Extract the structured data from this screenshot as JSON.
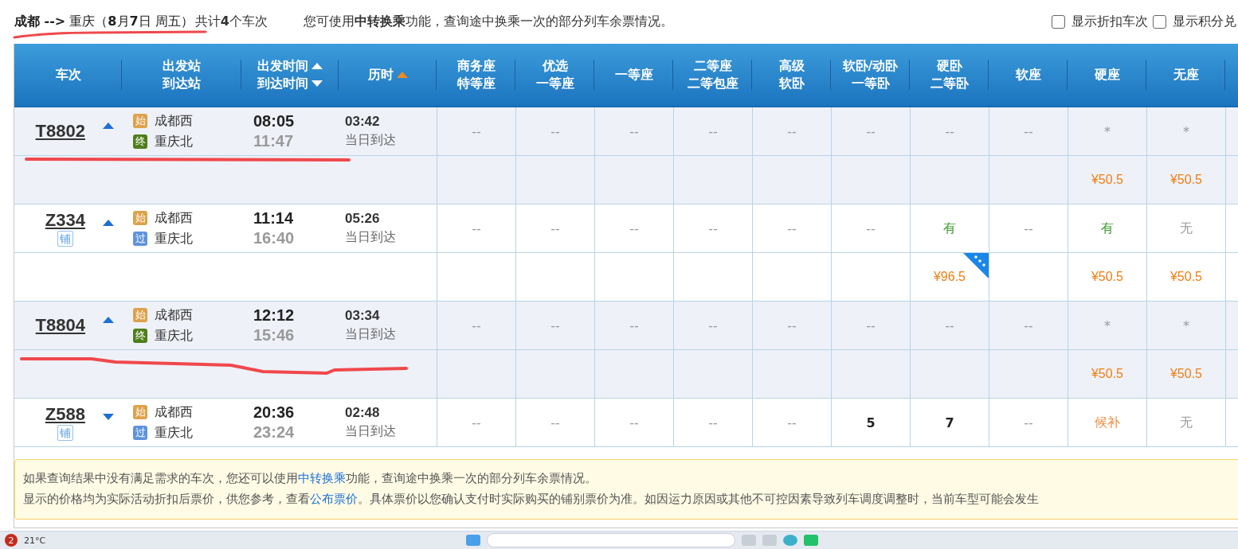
{
  "summary": {
    "route": "**成都 -->** 重庆（**8**月**7**日  周五）",
    "count": "共计**4**个车次",
    "notice": "您可使用**中转换乘**功能，查询途中换乘一次的部分列车余票情况。"
  },
  "filters": [
    {
      "label": "显示折扣车次",
      "checked": false
    },
    {
      "label": "显示积分兑",
      "checked": false
    }
  ],
  "columns": [
    {
      "lines": [
        "车次"
      ],
      "kind": "plain"
    },
    {
      "lines": [
        "出发站",
        "到达站"
      ],
      "kind": "plain"
    },
    {
      "lines": [
        "出发时间",
        "到达时间"
      ],
      "kind": "sortpair"
    },
    {
      "lines": [
        "历时"
      ],
      "kind": "sorted"
    },
    {
      "lines": [
        "商务座",
        "特等座"
      ],
      "kind": "plain"
    },
    {
      "lines": [
        "优选",
        "一等座"
      ],
      "kind": "plain"
    },
    {
      "lines": [
        "一等座"
      ],
      "kind": "plain"
    },
    {
      "lines": [
        "二等座",
        "二等包座"
      ],
      "kind": "plain"
    },
    {
      "lines": [
        "高级",
        "软卧"
      ],
      "kind": "plain"
    },
    {
      "lines": [
        "软卧/动卧",
        "一等卧"
      ],
      "kind": "plain"
    },
    {
      "lines": [
        "硬卧",
        "二等卧"
      ],
      "kind": "plain"
    },
    {
      "lines": [
        "软座"
      ],
      "kind": "plain"
    },
    {
      "lines": [
        "硬座"
      ],
      "kind": "plain"
    },
    {
      "lines": [
        "无座"
      ],
      "kind": "plain"
    }
  ],
  "trains": [
    {
      "number": "T8802",
      "expanded": true,
      "from": {
        "tag": "始",
        "kind": "start",
        "name": "成都西"
      },
      "to": {
        "tag": "终",
        "kind": "end",
        "name": "重庆北"
      },
      "depart": "08:05",
      "arrive": "11:47",
      "duration": "03:42",
      "arrival_day": "当日到达",
      "seats": [
        {
          "text": "--",
          "kind": "none"
        },
        {
          "text": "--",
          "kind": "none"
        },
        {
          "text": "--",
          "kind": "none"
        },
        {
          "text": "--",
          "kind": "none"
        },
        {
          "text": "--",
          "kind": "none"
        },
        {
          "text": "--",
          "kind": "none"
        },
        {
          "text": "--",
          "kind": "none"
        },
        {
          "text": "--",
          "kind": "none"
        },
        {
          "text": "*",
          "kind": "none",
          "price": "¥50.5",
          "discount": false
        },
        {
          "text": "*",
          "kind": "none",
          "price": "¥50.5",
          "discount": false
        }
      ]
    },
    {
      "number": "Z334",
      "badge": "铺",
      "expanded": true,
      "from": {
        "tag": "始",
        "kind": "start",
        "name": "成都西"
      },
      "to": {
        "tag": "过",
        "kind": "pass",
        "name": "重庆北"
      },
      "depart": "11:14",
      "arrive": "16:40",
      "duration": "05:26",
      "arrival_day": "当日到达",
      "seats": [
        {
          "text": "--",
          "kind": "none"
        },
        {
          "text": "--",
          "kind": "none"
        },
        {
          "text": "--",
          "kind": "none"
        },
        {
          "text": "--",
          "kind": "none"
        },
        {
          "text": "--",
          "kind": "none"
        },
        {
          "text": "--",
          "kind": "none"
        },
        {
          "text": "有",
          "kind": "available",
          "price": "¥96.5",
          "discount": true
        },
        {
          "text": "--",
          "kind": "none"
        },
        {
          "text": "有",
          "kind": "available",
          "price": "¥50.5",
          "discount": false
        },
        {
          "text": "无",
          "kind": "none",
          "price": "¥50.5",
          "discount": false
        }
      ]
    },
    {
      "number": "T8804",
      "expanded": true,
      "from": {
        "tag": "始",
        "kind": "start",
        "name": "成都西"
      },
      "to": {
        "tag": "终",
        "kind": "end",
        "name": "重庆北"
      },
      "depart": "12:12",
      "arrive": "15:46",
      "duration": "03:34",
      "arrival_day": "当日到达",
      "seats": [
        {
          "text": "--",
          "kind": "none"
        },
        {
          "text": "--",
          "kind": "none"
        },
        {
          "text": "--",
          "kind": "none"
        },
        {
          "text": "--",
          "kind": "none"
        },
        {
          "text": "--",
          "kind": "none"
        },
        {
          "text": "--",
          "kind": "none"
        },
        {
          "text": "--",
          "kind": "none"
        },
        {
          "text": "--",
          "kind": "none"
        },
        {
          "text": "*",
          "kind": "none",
          "price": "¥50.5",
          "discount": false
        },
        {
          "text": "*",
          "kind": "none",
          "price": "¥50.5",
          "discount": false
        }
      ]
    },
    {
      "number": "Z588",
      "badge": "铺",
      "expanded": false,
      "from": {
        "tag": "始",
        "kind": "start",
        "name": "成都西"
      },
      "to": {
        "tag": "过",
        "kind": "pass",
        "name": "重庆北"
      },
      "depart": "20:36",
      "arrive": "23:24",
      "duration": "02:48",
      "arrival_day": "当日到达",
      "seats": [
        {
          "text": "--",
          "kind": "none"
        },
        {
          "text": "--",
          "kind": "none"
        },
        {
          "text": "--",
          "kind": "none"
        },
        {
          "text": "--",
          "kind": "none"
        },
        {
          "text": "--",
          "kind": "none"
        },
        {
          "text": "5",
          "kind": "count"
        },
        {
          "text": "7",
          "kind": "count"
        },
        {
          "text": "--",
          "kind": "none"
        },
        {
          "text": "候补",
          "kind": "waitlist"
        },
        {
          "text": "无",
          "kind": "none"
        }
      ]
    }
  ],
  "tips": [
    {
      "before": "如果查询结果中没有满足需求的车次，您还可以使用",
      "link": "中转换乘",
      "after": "功能，查询途中换乘一次的部分列车余票情况。"
    },
    {
      "before": "显示的价格均为实际活动折扣后票价，供您参考，查看",
      "link": "公布票价",
      "after": "。具体票价以您确认支付时实际购买的铺别票价为准。如因运力原因或其他不可控因素导致列车调度调整时，当前车型可能会发生"
    }
  ],
  "taskbar": {
    "badge": "2",
    "weather": "21°C"
  }
}
